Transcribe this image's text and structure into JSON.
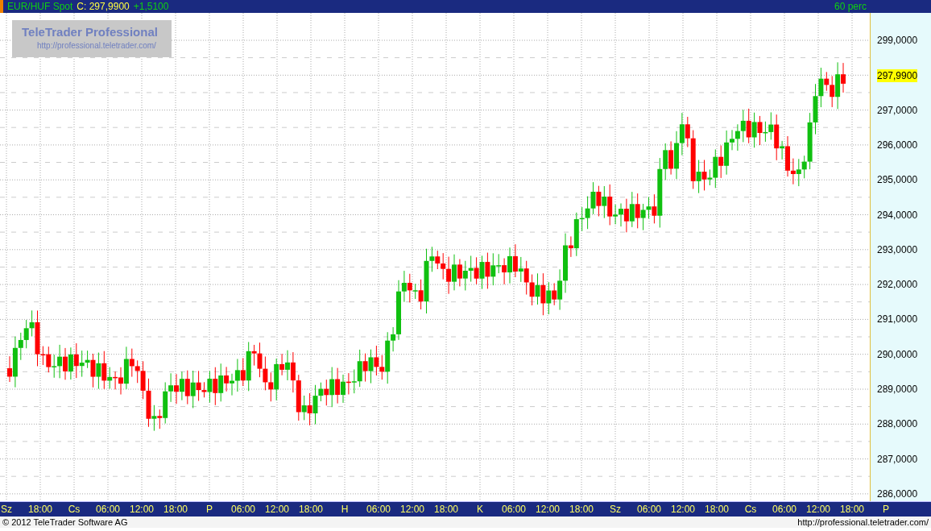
{
  "header": {
    "instrument": "EUR/HUF Spot",
    "close": "C: 297,9900",
    "change": "+1,5100",
    "interval": "60 perc"
  },
  "logo": {
    "title": "TeleTrader Professional",
    "url": "http://professional.teletrader.com/"
  },
  "price_axis": {
    "labels": [
      {
        "kind": "tick",
        "text": "299,0000"
      },
      {
        "kind": "current",
        "text": "297,9900"
      },
      {
        "kind": "tick",
        "text": "297,0000"
      },
      {
        "kind": "tick",
        "text": "296,0000"
      },
      {
        "kind": "tick",
        "text": "295,0000"
      },
      {
        "kind": "tick",
        "text": "294,0000"
      },
      {
        "kind": "tick",
        "text": "293,0000"
      },
      {
        "kind": "tick",
        "text": "292,0000"
      },
      {
        "kind": "tick",
        "text": "291,0000"
      },
      {
        "kind": "tick",
        "text": "290,0000"
      },
      {
        "kind": "tick",
        "text": "289,0000"
      },
      {
        "kind": "tick",
        "text": "288,0000"
      },
      {
        "kind": "tick",
        "text": "287,0000"
      },
      {
        "kind": "tick",
        "text": "286,0000"
      }
    ]
  },
  "time_axis": {
    "labels": [
      "Sz",
      "18:00",
      "Cs",
      "06:00",
      "12:00",
      "18:00",
      "P",
      "06:00",
      "12:00",
      "18:00",
      "H",
      "06:00",
      "12:00",
      "18:00",
      "K",
      "06:00",
      "12:00",
      "18:00",
      "Sz",
      "06:00",
      "12:00",
      "18:00",
      "Cs",
      "06:00",
      "12:00",
      "18:00",
      "P"
    ]
  },
  "footer": {
    "copyright": "© 2012 TeleTrader Software AG",
    "url": "http://professional.teletrader.com/"
  }
}
